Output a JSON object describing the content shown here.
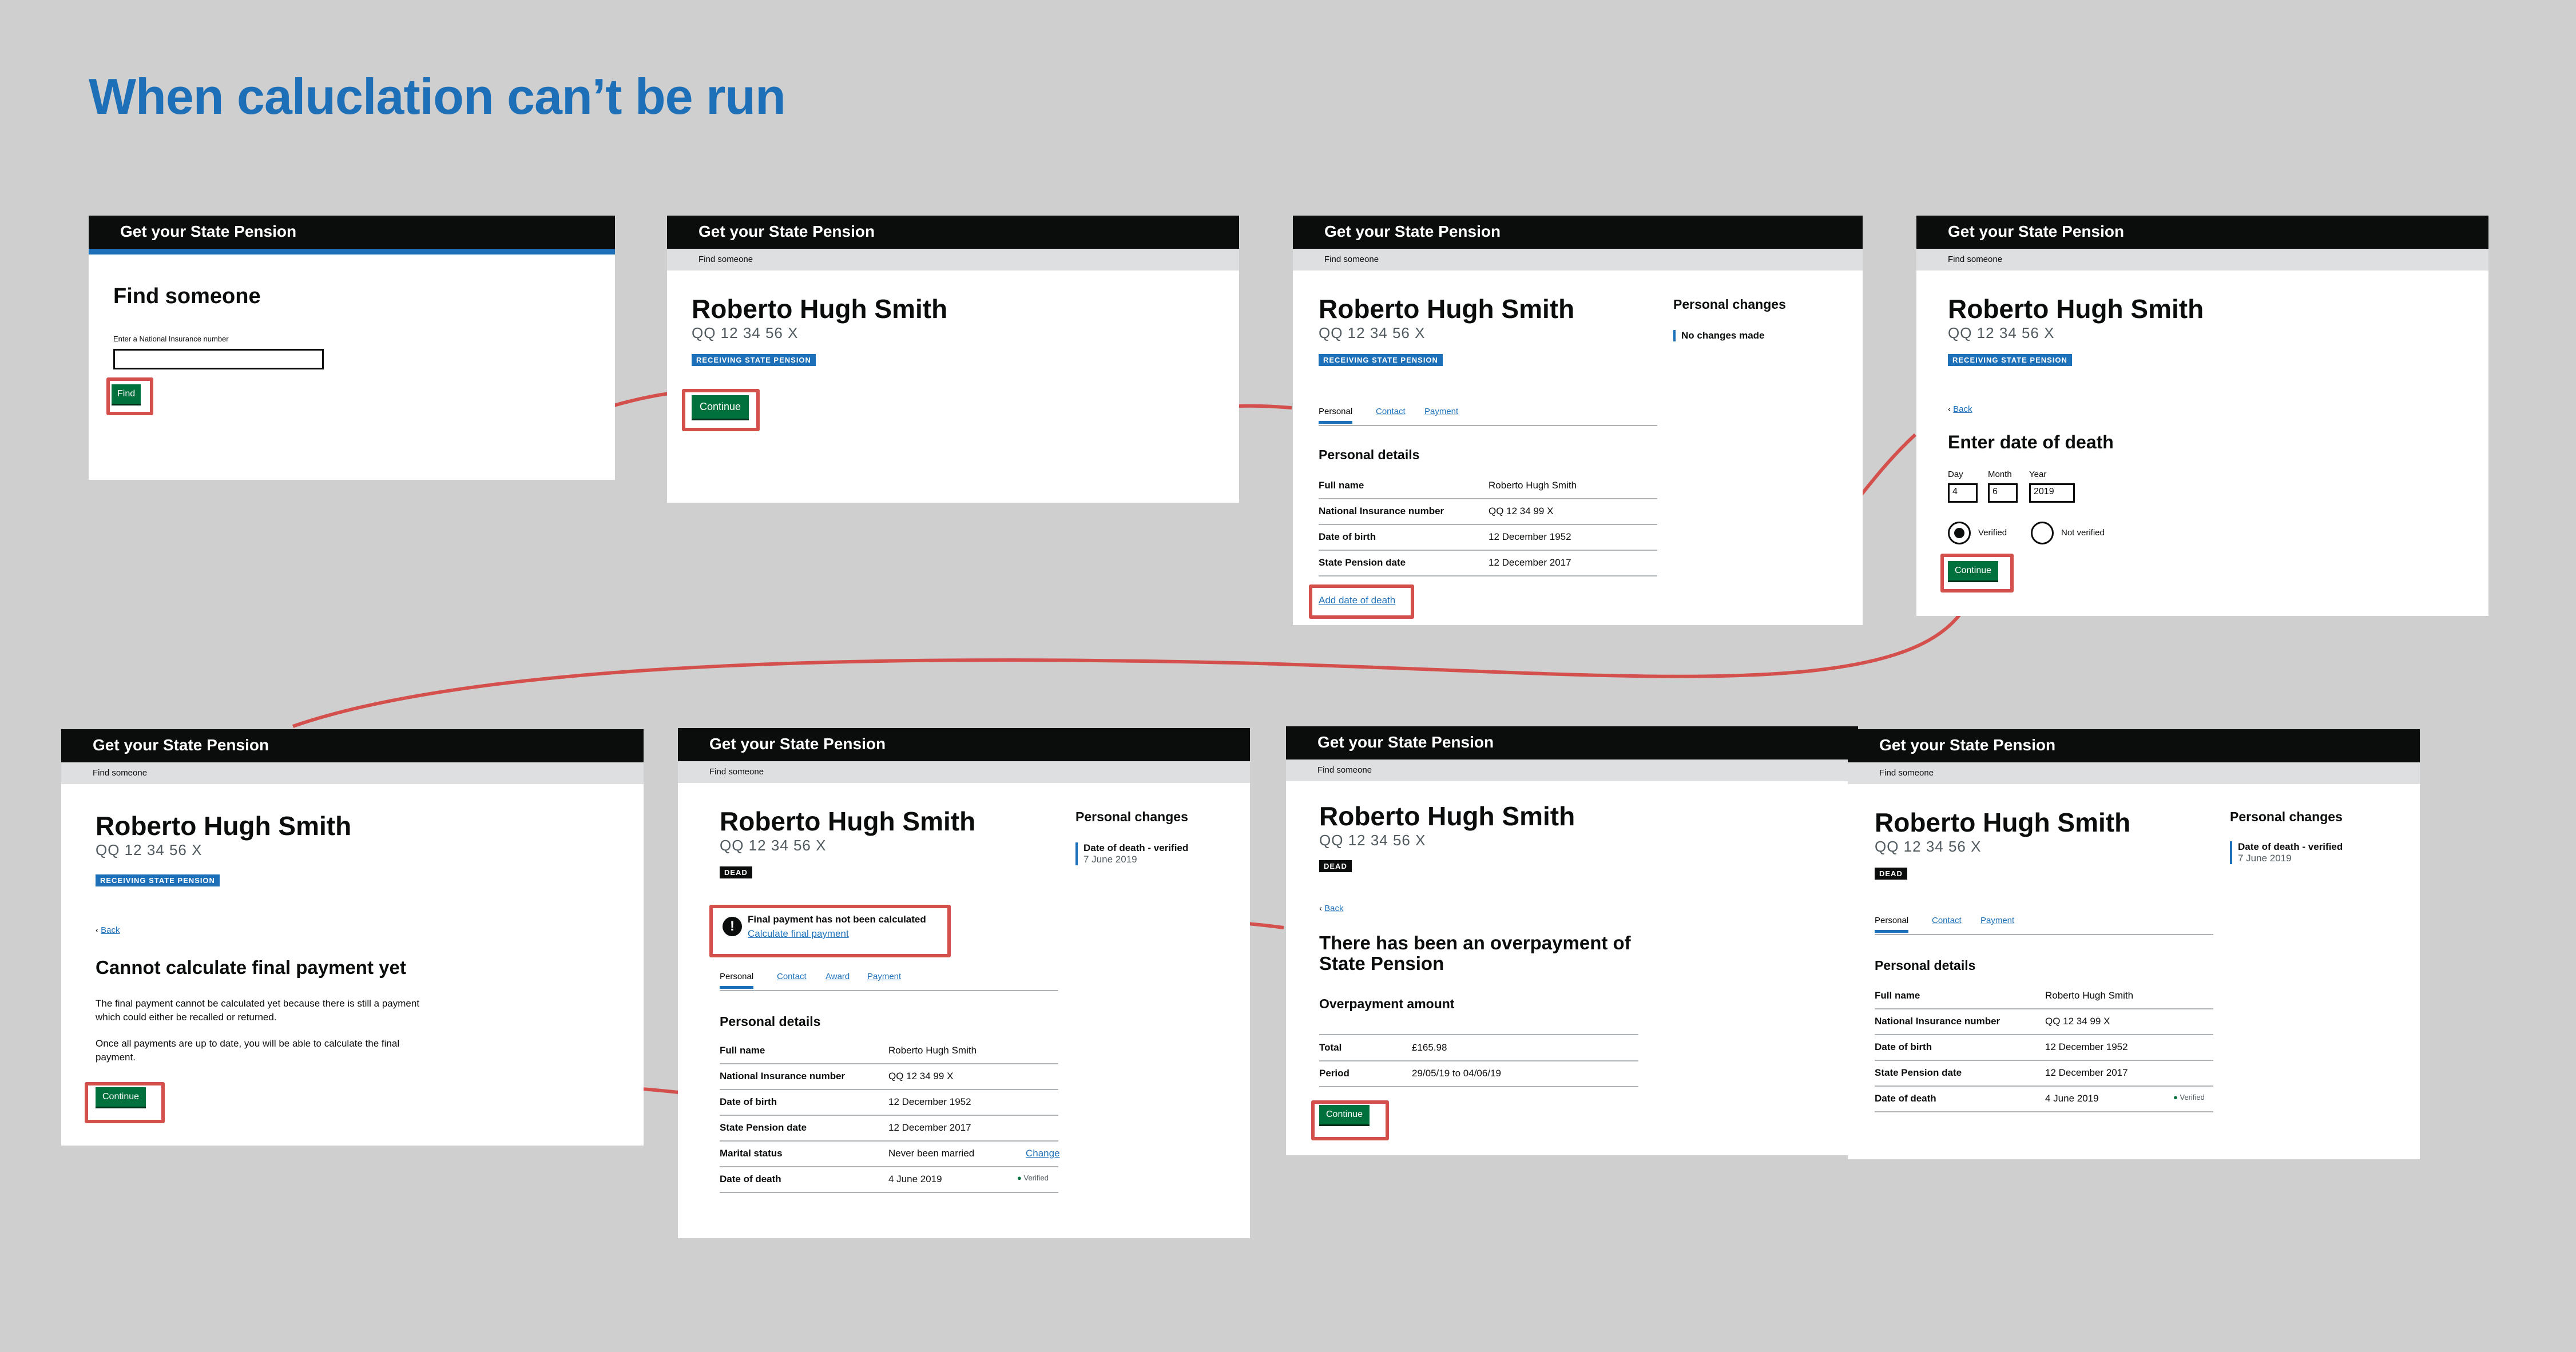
{
  "page_title": "When caluclation can’t be run",
  "service_name": "Get your State Pension",
  "breadcrumb": "Find someone",
  "person": {
    "name": "Roberto Hugh Smith",
    "nino": "QQ 12 34 56 X",
    "nino_short": "QQ 12 34 99 X",
    "tag_receiving": "RECEIVING STATE PENSION",
    "tag_dead": "DEAD"
  },
  "screen1": {
    "heading": "Find someone",
    "label": "Enter a National Insurance number",
    "button": "Find"
  },
  "common": {
    "continue": "Continue",
    "back": "Back"
  },
  "tabs": {
    "personal": "Personal",
    "contact": "Contact",
    "award": "Award",
    "payment": "Payment"
  },
  "changes": {
    "heading": "Personal changes",
    "none": "No changes made",
    "death_verified": "Date of death - verified",
    "death_date": "7 June 2019"
  },
  "details": {
    "heading": "Personal details",
    "full_name_label": "Full name",
    "full_name": "Roberto Hugh Smith",
    "nino_label": "National Insurance number",
    "dob_label": "Date of birth",
    "dob": "12 December 1952",
    "spd_label": "State Pension date",
    "spd": "12 December 2017",
    "marital_label": "Marital status",
    "marital": "Never been married",
    "change": "Change",
    "dod_label": "Date of death",
    "dod": "4 June 2019",
    "verified": "Verified"
  },
  "screen3": {
    "add_death_link": "Add date of death"
  },
  "screen4": {
    "heading": "Enter date of death",
    "day_label": "Day",
    "month_label": "Month",
    "year_label": "Year",
    "day": "4",
    "month": "6",
    "year": "2019",
    "verified": "Verified",
    "not_verified": "Not verified"
  },
  "screen5": {
    "heading": "Cannot calculate final payment yet",
    "para1_line1": "The final payment cannot be calculated yet because there is still a payment",
    "para1_line2": "which could either be recalled or returned.",
    "para2_line1": "Once all payments are up to date, you will be able to calculate the final",
    "para2_line2": "payment."
  },
  "screen6": {
    "warning": "Final payment has not been calculated",
    "calc_link": "Calculate final payment"
  },
  "screen7": {
    "heading_line1": "There has been an overpayment of",
    "heading_line2": "State Pension",
    "subheading": "Overpayment amount",
    "total_label": "Total",
    "total": "£165.98",
    "period_label": "Period",
    "period": "29/05/19 to 04/06/19"
  },
  "colors": {
    "accent": "#1d70b8",
    "button": "#00703c",
    "highlight": "#d4504d",
    "background": "#d0cfd0"
  }
}
